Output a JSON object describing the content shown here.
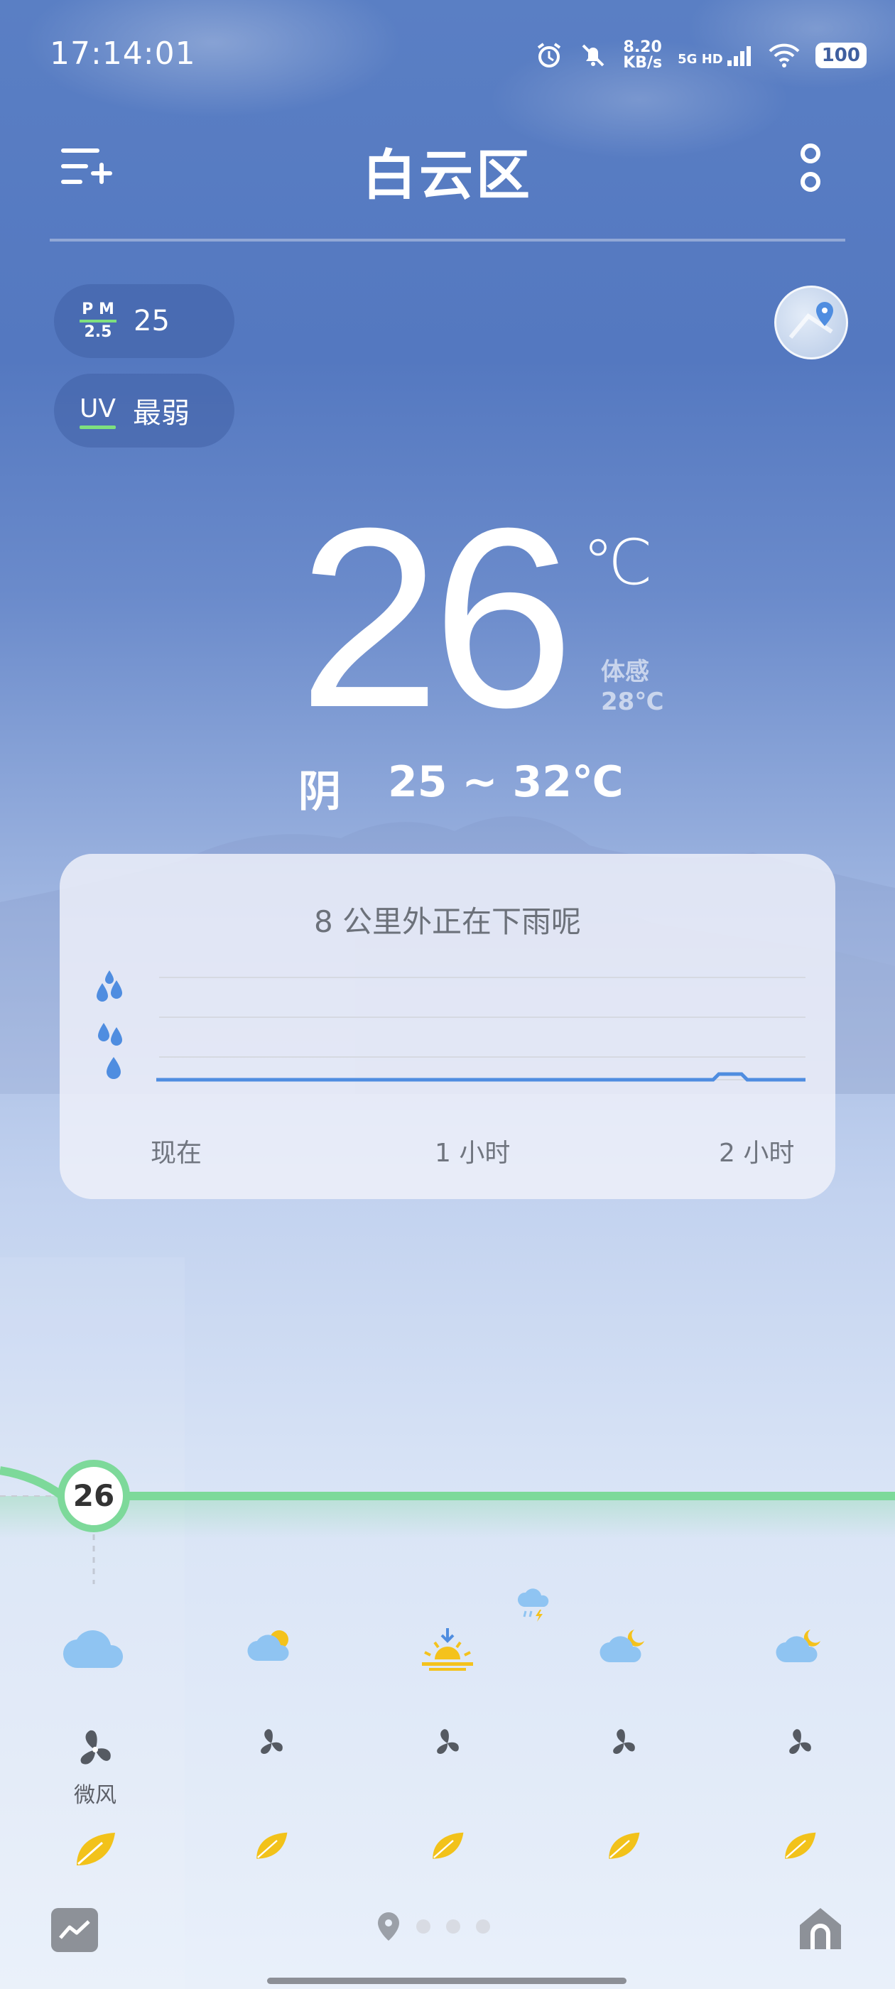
{
  "status_bar": {
    "time": "17:14:01",
    "speed_value": "8.20",
    "speed_unit": "KB/s",
    "network": "5G HD",
    "battery": "100"
  },
  "header": {
    "title": "白云区"
  },
  "air": {
    "pm_label_top": "P M",
    "pm_label_bottom": "2.5",
    "pm_value": "25",
    "uv_label": "UV",
    "uv_value": "最弱"
  },
  "current": {
    "temperature": "26",
    "unit": "℃",
    "feels_like_label": "体感",
    "feels_like_value": "28℃",
    "condition": "阴",
    "range": "25 ~ 32℃"
  },
  "rain_card": {
    "title": "8 公里外正在下雨呢",
    "labels": [
      "现在",
      "1 小时",
      "2 小时"
    ]
  },
  "timeline": {
    "current_temp": "26",
    "wind_label": "微风",
    "colors": {
      "line": "#7dd99a",
      "cloud": "#8fc4f2",
      "sun": "#f4c21c",
      "leaf": "#f2c21a",
      "fan": "#555a62"
    },
    "icons": [
      "cloud-icon",
      "partly-sunny-icon",
      "sunset-icon",
      "cloudy-night-icon",
      "cloudy-night-icon"
    ],
    "extra_icon": "thunder-rain-icon"
  },
  "colors": {
    "sky_top": "#5a7fc4",
    "sky_bottom": "#e9f0fa",
    "pm_bar": "#7ee07e"
  }
}
